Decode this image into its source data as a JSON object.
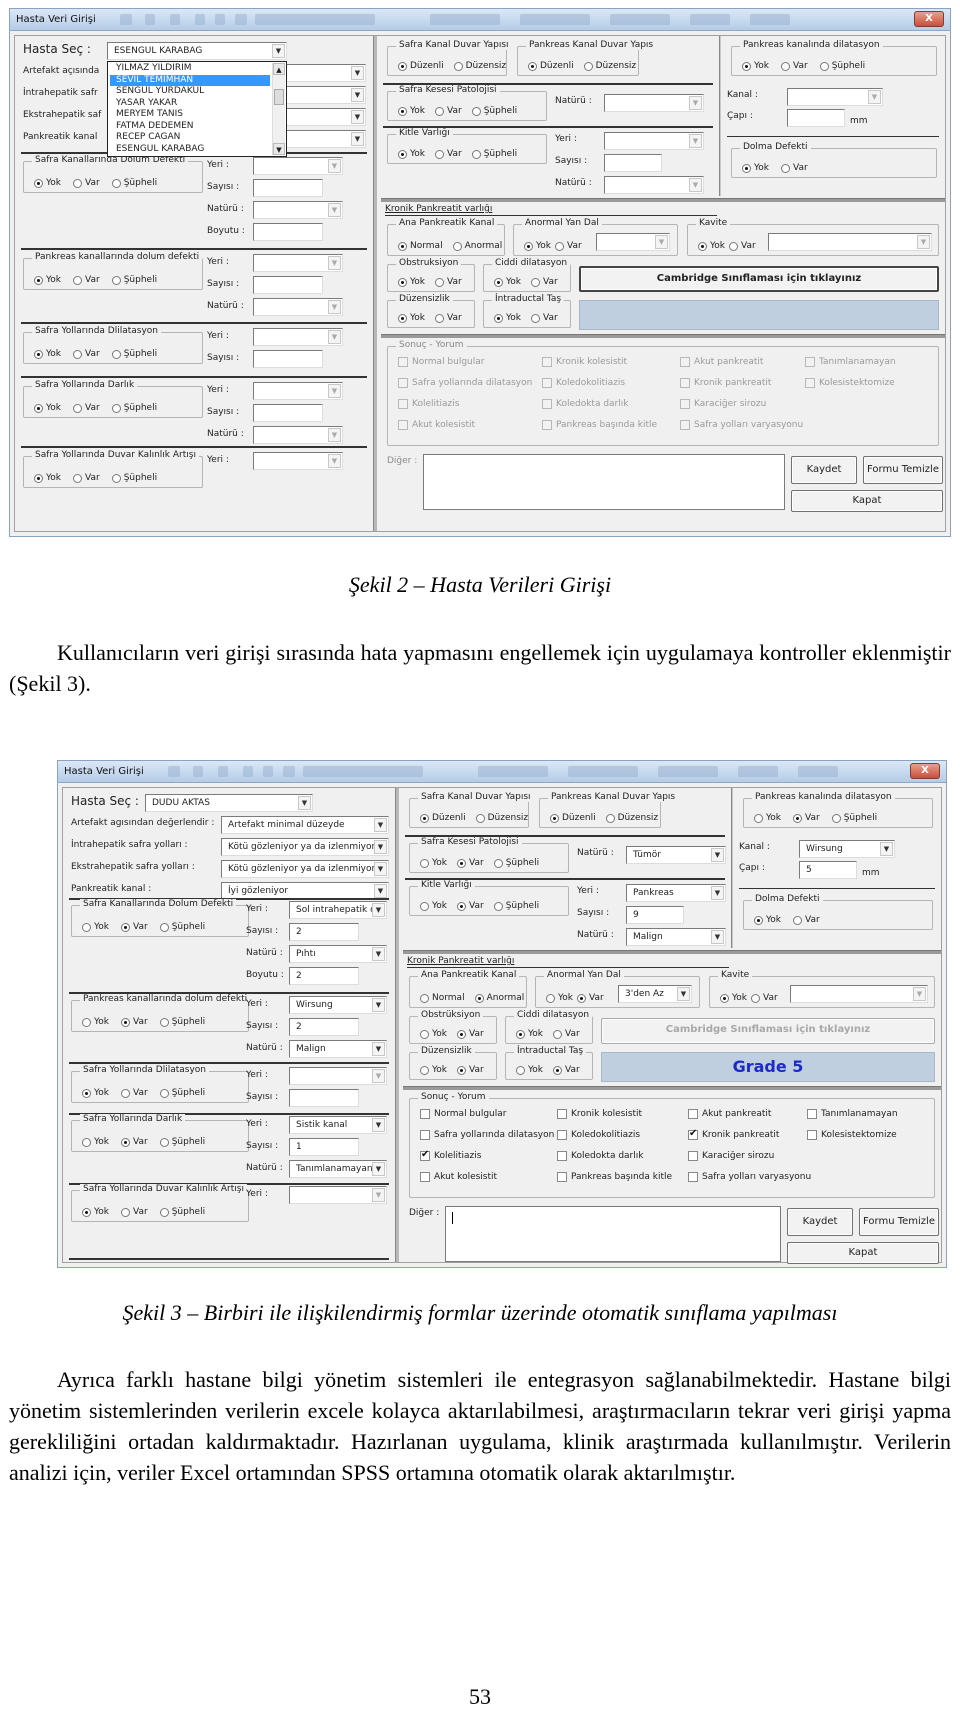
{
  "figure2": {
    "window_title": "Hasta Veri Girişi",
    "close_label": "X",
    "hasta_sec_label": "Hasta Seç :",
    "hasta_sec_value": "ESENGUL KARABAG",
    "dropdown_options": [
      "YILMAZ YILDIRIM",
      "SEVIL TEMIMHAN",
      "SENGUL YURDAKUL",
      "YASAR YAKAR",
      "MERYEM TANIS",
      "FATMA  DEDEMEN",
      "RECEP CAGAN",
      "ESENGUL KARABAG"
    ],
    "dropdown_selected_index": 1,
    "left_labels": {
      "artefakt": "Artefakt açısında",
      "intrahepatik": "İntrahepatik safr",
      "ekstrahepatik": "Ekstrahepatik saf",
      "pankreatik": "Pankreatik kanal"
    },
    "left_groups": [
      {
        "title": "Safra Kanallarında Dolum Defekti",
        "options": [
          "Yok",
          "Var",
          "Şüpheli"
        ],
        "selected": 0,
        "fields": [
          {
            "label": "Yeri :",
            "type": "combo",
            "value": ""
          },
          {
            "label": "Sayısı :",
            "type": "text",
            "value": ""
          },
          {
            "label": "Natürü :",
            "type": "combo",
            "value": ""
          },
          {
            "label": "Boyutu :",
            "type": "text",
            "value": ""
          }
        ]
      },
      {
        "title": "Pankreas kanallarında dolum defekti",
        "options": [
          "Yok",
          "Var",
          "Şüpheli"
        ],
        "selected": 0,
        "fields": [
          {
            "label": "Yeri :",
            "type": "combo",
            "value": ""
          },
          {
            "label": "Sayısı :",
            "type": "text",
            "value": ""
          },
          {
            "label": "Natürü :",
            "type": "combo",
            "value": ""
          }
        ]
      },
      {
        "title": "Safra Yollarında Dlilatasyon",
        "options": [
          "Yok",
          "Var",
          "Şüpheli"
        ],
        "selected": 0,
        "fields": [
          {
            "label": "Yeri :",
            "type": "combo",
            "value": ""
          },
          {
            "label": "Sayısı :",
            "type": "text",
            "value": ""
          }
        ]
      },
      {
        "title": "Safra Yollarında Darlık",
        "options": [
          "Yok",
          "Var",
          "Şüpheli"
        ],
        "selected": 0,
        "fields": [
          {
            "label": "Yeri :",
            "type": "combo",
            "value": ""
          },
          {
            "label": "Sayısı :",
            "type": "text",
            "value": ""
          },
          {
            "label": "Natürü :",
            "type": "combo",
            "value": ""
          }
        ]
      },
      {
        "title": "Safra Yollarında Duvar Kalınlık Artışı",
        "options": [
          "Yok",
          "Var",
          "Şüpheli"
        ],
        "selected": 0,
        "fields": [
          {
            "label": "Yeri :",
            "type": "combo",
            "value": ""
          }
        ]
      }
    ],
    "safra_kanal_duvar": {
      "title": "Safra Kanal Duvar Yapısı",
      "options": [
        "Düzenli",
        "Düzensiz"
      ],
      "selected": 0
    },
    "pankreas_kanal_duvar": {
      "title": "Pankreas Kanal Duvar Yapıs",
      "options": [
        "Düzenli",
        "Düzensiz"
      ],
      "selected": 0
    },
    "safra_kesesi": {
      "title": "Safra Kesesi Patolojisi",
      "options": [
        "Yok",
        "Var",
        "Şüpheli"
      ],
      "selected": 0,
      "naturu_label": "Natürü :",
      "naturu_value": ""
    },
    "kitle": {
      "title": "Kitle Varlığı",
      "options": [
        "Yok",
        "Var",
        "Şüpheli"
      ],
      "selected": 0,
      "yeri_label": "Yeri :",
      "yeri_value": "",
      "sayisi_label": "Sayısı :",
      "sayisi_value": "",
      "naturu_label": "Natürü :",
      "naturu_value": ""
    },
    "pankreas_dilatasyon": {
      "title": "Pankreas kanalında dilatasyon",
      "options": [
        "Yok",
        "Var",
        "Şüpheli"
      ],
      "selected": 0,
      "kanal_label": "Kanal :",
      "kanal_value": "",
      "capi_label": "Çapı :",
      "capi_value": "",
      "unit": "mm"
    },
    "dolma_defekti": {
      "title": "Dolma Defekti",
      "options": [
        "Yok",
        "Var"
      ],
      "selected": 0
    },
    "kronik_title": "Kronik Pankreatit varlığı",
    "ana_pankreatik": {
      "title": "Ana Pankreatik Kanal",
      "options": [
        "Normal",
        "Anormal"
      ],
      "selected": 0
    },
    "anormal_yan_dal": {
      "title": "Anormal Yan Dal",
      "options": [
        "Yok",
        "Var"
      ],
      "selected": 0,
      "value": ""
    },
    "kavite": {
      "title": "Kavite",
      "options": [
        "Yok",
        "Var"
      ],
      "selected": 0,
      "value": ""
    },
    "obstruksiyon": {
      "title": "Obstruksiyon",
      "options": [
        "Yok",
        "Var"
      ],
      "selected": 0
    },
    "ciddi": {
      "title": "Ciddi dilatasyon",
      "options": [
        "Yok",
        "Var"
      ],
      "selected": 0
    },
    "duzensizlik": {
      "title": "Düzensizlik",
      "options": [
        "Yok",
        "Var"
      ],
      "selected": 0
    },
    "intraductal": {
      "title": "İntraductal Taş",
      "options": [
        "Yok",
        "Var"
      ],
      "selected": 0
    },
    "cambridge_button": "Cambridge Sınıflaması için tıklayınız",
    "grade_text": "",
    "sonuc_title": "Sonuç - Yorum",
    "sonuc_items": [
      {
        "label": "Normal bulgular",
        "checked": false
      },
      {
        "label": "Kronik kolesistit",
        "checked": false
      },
      {
        "label": "Akut pankreatit",
        "checked": false
      },
      {
        "label": "Tanımlanamayan",
        "checked": false
      },
      {
        "label": "Safra yollarında dilatasyon",
        "checked": false
      },
      {
        "label": "Koledokolitiazis",
        "checked": false
      },
      {
        "label": "Kronik pankreatit",
        "checked": false
      },
      {
        "label": "Kolesistektomize",
        "checked": false
      },
      {
        "label": "Kolelitiazis",
        "checked": false
      },
      {
        "label": "Koledokta darlık",
        "checked": false
      },
      {
        "label": "Karaciğer sirozu",
        "checked": false
      },
      {
        "label": "Akut kolesistit",
        "checked": false
      },
      {
        "label": "Pankreas başında kitle",
        "checked": false
      },
      {
        "label": "Safra yolları varyasyonu",
        "checked": false
      }
    ],
    "sonuc_disabled": true,
    "diger_label": "Diğer :",
    "diger_value": "",
    "kaydet": "Kaydet",
    "formu_temizle": "Formu Temizle",
    "kapat": "Kapat"
  },
  "caption2": "Şekil 2 – Hasta Verileri Girişi",
  "para1": "Kullanıcıların veri girişi sırasında hata yapmasını engellemek için uygulamaya kontroller eklenmiştir (Şekil 3).",
  "figure3": {
    "window_title": "Hasta Veri Girişi",
    "close_label": "X",
    "hasta_sec_label": "Hasta Seç :",
    "hasta_sec_value": "DUDU AKTAS",
    "top_fields": [
      {
        "label": "Artefakt agısından değerlendir :",
        "value": "Artefakt minimal düzeyde"
      },
      {
        "label": "İntrahepatik safra yolları :",
        "value": "Kötü gözleniyor ya da izlenmiyor"
      },
      {
        "label": "Ekstrahepatik safra yolları :",
        "value": "Kötü gözleniyor ya da izlenmiyor"
      },
      {
        "label": "Pankreatik kanal :",
        "value": "İyi gözleniyor"
      }
    ],
    "left_groups": [
      {
        "title": "Safra Kanallarında Dolum Defekti",
        "options": [
          "Yok",
          "Var",
          "Şüpheli"
        ],
        "selected": 1,
        "fields": [
          {
            "label": "Yeri :",
            "type": "combo",
            "value": "Sol intrahepatik da"
          },
          {
            "label": "Sayısı :",
            "type": "text",
            "value": "2"
          },
          {
            "label": "Natürü :",
            "type": "combo",
            "value": "Pıhtı"
          },
          {
            "label": "Boyutu :",
            "type": "text",
            "value": "2"
          }
        ]
      },
      {
        "title": "Pankreas kanallarında dolum defekti",
        "options": [
          "Yok",
          "Var",
          "Şüpheli"
        ],
        "selected": 1,
        "fields": [
          {
            "label": "Yeri :",
            "type": "combo",
            "value": "Wirsung"
          },
          {
            "label": "Sayısı :",
            "type": "text",
            "value": "2"
          },
          {
            "label": "Natürü :",
            "type": "combo",
            "value": "Malign"
          }
        ]
      },
      {
        "title": "Safra Yollarında Dlilatasyon",
        "options": [
          "Yok",
          "Var",
          "Şüpheli"
        ],
        "selected": 0,
        "fields": [
          {
            "label": "Yeri :",
            "type": "combo",
            "value": ""
          },
          {
            "label": "Sayısı :",
            "type": "text",
            "value": ""
          }
        ]
      },
      {
        "title": "Safra Yollarında Darlık",
        "options": [
          "Yok",
          "Var",
          "Şüpheli"
        ],
        "selected": 1,
        "fields": [
          {
            "label": "Yeri :",
            "type": "combo",
            "value": "Sistik kanal"
          },
          {
            "label": "Sayısı :",
            "type": "text",
            "value": "1"
          },
          {
            "label": "Natürü :",
            "type": "combo",
            "value": "Tanımlanamayan"
          }
        ]
      },
      {
        "title": "Safra Yollarında Duvar Kalınlık Artışı",
        "options": [
          "Yok",
          "Var",
          "Şüpheli"
        ],
        "selected": 0,
        "fields": [
          {
            "label": "Yeri :",
            "type": "combo",
            "value": ""
          }
        ]
      }
    ],
    "safra_kanal_duvar": {
      "title": "Safra Kanal Duvar Yapısı",
      "options": [
        "Düzenli",
        "Düzensiz"
      ],
      "selected": 0
    },
    "pankreas_kanal_duvar": {
      "title": "Pankreas Kanal Duvar Yapıs",
      "options": [
        "Düzenli",
        "Düzensiz"
      ],
      "selected": 0
    },
    "safra_kesesi": {
      "title": "Safra Kesesi Patolojisi",
      "options": [
        "Yok",
        "Var",
        "Şüpheli"
      ],
      "selected": 1,
      "naturu_label": "Natürü :",
      "naturu_value": "Tümör"
    },
    "kitle": {
      "title": "Kitle Varlığı",
      "options": [
        "Yok",
        "Var",
        "Şüpheli"
      ],
      "selected": 1,
      "yeri_label": "Yeri :",
      "yeri_value": "Pankreas",
      "sayisi_label": "Sayısı :",
      "sayisi_value": "9",
      "naturu_label": "Natürü :",
      "naturu_value": "Malign"
    },
    "pankreas_dilatasyon": {
      "title": "Pankreas kanalında dilatasyon",
      "options": [
        "Yok",
        "Var",
        "Şüpheli"
      ],
      "selected": 1,
      "kanal_label": "Kanal :",
      "kanal_value": "Wirsung",
      "capi_label": "Çapı :",
      "capi_value": "5",
      "unit": "mm"
    },
    "dolma_defekti": {
      "title": "Dolma Defekti",
      "options": [
        "Yok",
        "Var"
      ],
      "selected": 0
    },
    "kronik_title": "Kronik Pankreatit varlığı",
    "ana_pankreatik": {
      "title": "Ana Pankreatik Kanal",
      "options": [
        "Normal",
        "Anormal"
      ],
      "selected": 1
    },
    "anormal_yan_dal": {
      "title": "Anormal Yan Dal",
      "options": [
        "Yok",
        "Var"
      ],
      "selected": 1,
      "value": "3'den Az"
    },
    "kavite": {
      "title": "Kavite",
      "options": [
        "Yok",
        "Var"
      ],
      "selected": 0,
      "value": ""
    },
    "obstruksiyon": {
      "title": "Obstrüksiyon",
      "options": [
        "Yok",
        "Var"
      ],
      "selected": 1
    },
    "ciddi": {
      "title": "Ciddi dilatasyon",
      "options": [
        "Yok",
        "Var"
      ],
      "selected": 0
    },
    "duzensizlik": {
      "title": "Düzensizlik",
      "options": [
        "Yok",
        "Var"
      ],
      "selected": 1
    },
    "intraductal": {
      "title": "İntraductal Taş",
      "options": [
        "Yok",
        "Var"
      ],
      "selected": 1
    },
    "cambridge_button": "Cambridge Sınıflaması için tıklayınız",
    "grade_text": "Grade 5",
    "sonuc_title": "Sonuç - Yorum",
    "sonuc_items": [
      {
        "label": "Normal bulgular",
        "checked": false
      },
      {
        "label": "Kronik kolesistit",
        "checked": false
      },
      {
        "label": "Akut pankreatit",
        "checked": false
      },
      {
        "label": "Tanımlanamayan",
        "checked": false
      },
      {
        "label": "Safra yollarında dilatasyon",
        "checked": false
      },
      {
        "label": "Koledokolitiazis",
        "checked": false
      },
      {
        "label": "Kronik pankreatit",
        "checked": true
      },
      {
        "label": "Kolesistektomize",
        "checked": false
      },
      {
        "label": "Kolelitiazis",
        "checked": true
      },
      {
        "label": "Koledokta darlık",
        "checked": false
      },
      {
        "label": "Karaciğer sirozu",
        "checked": false
      },
      {
        "label": "Akut kolesistit",
        "checked": false
      },
      {
        "label": "Pankreas başında kitle",
        "checked": false
      },
      {
        "label": "Safra yolları varyasyonu",
        "checked": false
      }
    ],
    "sonuc_disabled": false,
    "diger_label": "Diğer :",
    "diger_value": "",
    "kaydet": "Kaydet",
    "formu_temizle": "Formu Temizle",
    "kapat": "Kapat"
  },
  "caption3": "Şekil 3 – Birbiri ile ilişkilendirmiş formlar üzerinde otomatik sınıflama yapılması",
  "para2": "Ayrıca farklı hastane bilgi yönetim sistemleri ile entegrasyon sağlanabilmektedir. Hastane bilgi yönetim sistemlerinden verilerin excele kolayca aktarılabilmesi, araştırmacıların tekrar veri girişi yapma gerekliliğini ortadan kaldırmaktadır. Hazırlanan uygulama, klinik araştırmada kullanılmıştır. Verilerin analizi için, veriler Excel ortamından SPSS ortamına otomatik olarak aktarılmıştır.",
  "page_number": "53"
}
